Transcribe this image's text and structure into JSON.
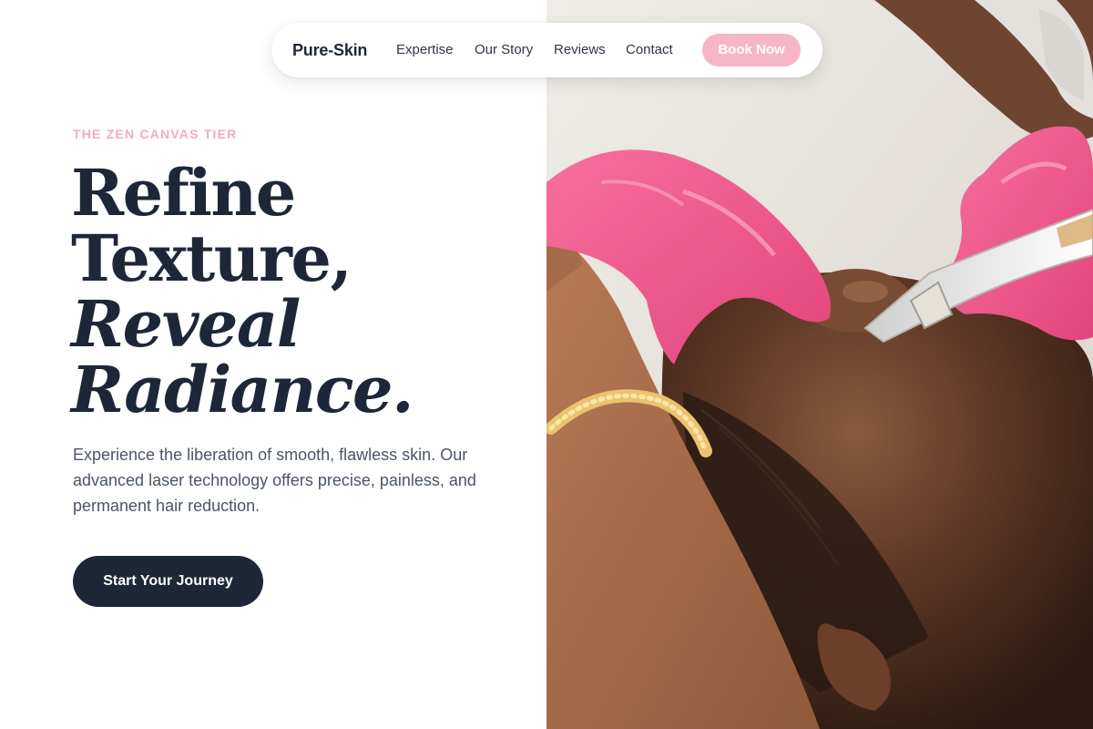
{
  "nav": {
    "brand": "Pure-Skin",
    "links": [
      "Expertise",
      "Our Story",
      "Reviews",
      "Contact"
    ],
    "cta": "Book Now"
  },
  "hero": {
    "eyebrow": "THE ZEN CANVAS TIER",
    "headline": {
      "line1": "Refine",
      "line2": "Texture,",
      "line3": "Reveal",
      "line4": "Radiance."
    },
    "description": "Experience the liberation of smooth, flawless skin. Our advanced laser technology offers precise, painless, and permanent hair reduction.",
    "cta": "Start Your Journey"
  },
  "colors": {
    "accent": "#f7b6c6",
    "eyebrow": "#f4aac0",
    "primary": "#1e2738"
  }
}
